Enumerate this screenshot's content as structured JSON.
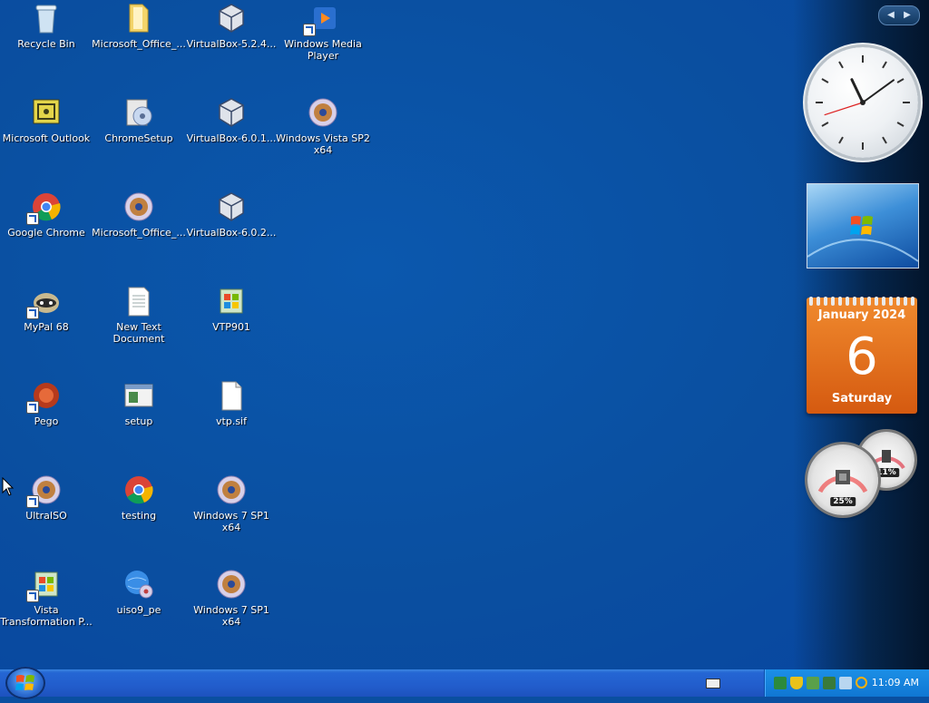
{
  "desktop": {
    "icons": [
      {
        "label": "Recycle Bin",
        "icon": "recycle-bin-icon"
      },
      {
        "label": "Microsoft_Office_...",
        "icon": "folder-icon"
      },
      {
        "label": "VirtualBox-5.2.4...",
        "icon": "virtualbox-icon"
      },
      {
        "label": "Windows Media Player",
        "icon": "media-player-icon"
      },
      {
        "label": "Microsoft Outlook",
        "icon": "outlook-icon"
      },
      {
        "label": "ChromeSetup",
        "icon": "installer-icon"
      },
      {
        "label": "VirtualBox-6.0.1...",
        "icon": "virtualbox-icon"
      },
      {
        "label": "Windows Vista SP2 x64",
        "icon": "disc-image-icon"
      },
      {
        "label": "Google Chrome",
        "icon": "chrome-icon"
      },
      {
        "label": "Microsoft_Office_...",
        "icon": "disc-image-icon"
      },
      {
        "label": "VirtualBox-6.0.2...",
        "icon": "virtualbox-icon"
      },
      {
        "label": "MyPal 68",
        "icon": "mypal-icon"
      },
      {
        "label": "New Text Document",
        "icon": "text-document-icon"
      },
      {
        "label": "VTP901",
        "icon": "vtp-icon"
      },
      {
        "label": "Pego",
        "icon": "pego-icon"
      },
      {
        "label": "setup",
        "icon": "setup-icon"
      },
      {
        "label": "vtp.sif",
        "icon": "file-icon"
      },
      {
        "label": "UltraISO",
        "icon": "ultraiso-icon"
      },
      {
        "label": "testing",
        "icon": "chrome-icon"
      },
      {
        "label": "Windows 7 SP1 x64",
        "icon": "disc-image-icon"
      },
      {
        "label": "Vista Transformation P...",
        "icon": "vtp-icon"
      },
      {
        "label": "uiso9_pe",
        "icon": "uiso-icon"
      },
      {
        "label": "Windows 7 SP1 x64",
        "icon": "disc-image-icon"
      }
    ]
  },
  "sidebar": {
    "calendar": {
      "month": "January 2024",
      "day": "6",
      "weekday": "Saturday"
    },
    "meters": {
      "cpu_percent": "25%",
      "memory_percent": "11%"
    },
    "clock": {
      "hour": 11,
      "minute": 9
    }
  },
  "taskbar": {
    "time": "11:09 AM"
  },
  "colors": {
    "desktop": "#0a4fa0",
    "taskbar": "#225dcc",
    "tray": "#1077d3",
    "calendar": "#e06a1c"
  }
}
